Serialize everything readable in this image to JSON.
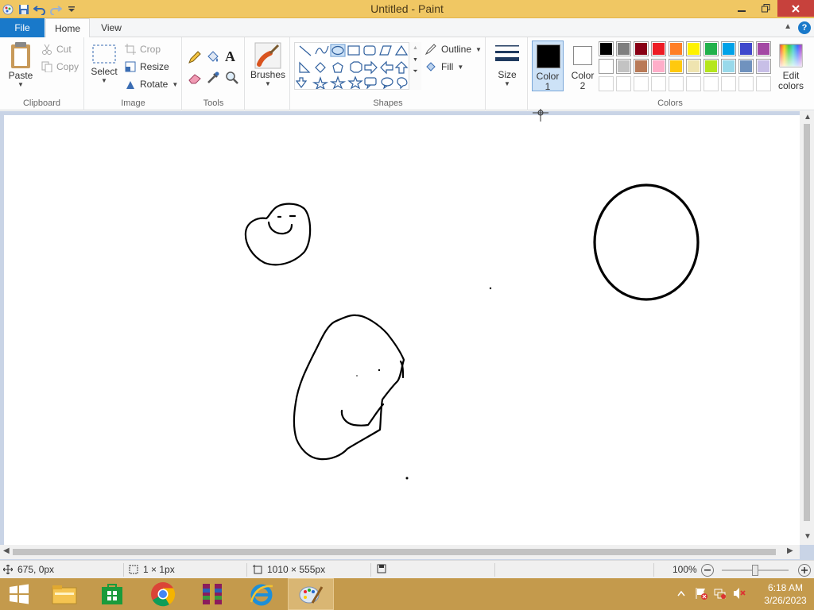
{
  "window": {
    "title": "Untitled - Paint"
  },
  "tabs": {
    "file": "File",
    "home": "Home",
    "view": "View"
  },
  "clipboard": {
    "paste": "Paste",
    "cut": "Cut",
    "copy": "Copy",
    "label": "Clipboard"
  },
  "image": {
    "select": "Select",
    "crop": "Crop",
    "resize": "Resize",
    "rotate": "Rotate",
    "label": "Image"
  },
  "tools": {
    "label": "Tools"
  },
  "brushes": {
    "label": "Brushes"
  },
  "shapes": {
    "outline": "Outline",
    "fill": "Fill",
    "label": "Shapes"
  },
  "size": {
    "label": "Size"
  },
  "colors": {
    "color1_line1": "Color",
    "color1_line2": "1",
    "color2_line1": "Color",
    "color2_line2": "2",
    "edit_line1": "Edit",
    "edit_line2": "colors",
    "label": "Colors",
    "color1_value": "#000000",
    "color2_value": "#ffffff",
    "palette_row1": [
      "#000000",
      "#7f7f7f",
      "#880015",
      "#ed1c24",
      "#ff7f27",
      "#fff200",
      "#22b14c",
      "#00a2e8",
      "#3f48cc",
      "#a349a4"
    ],
    "palette_row2": [
      "#ffffff",
      "#c3c3c3",
      "#b97a57",
      "#ffaec9",
      "#ffc90e",
      "#efe4b0",
      "#b5e61d",
      "#99d9ea",
      "#7092be",
      "#c8bfe7"
    ],
    "palette_row3": [
      "#ffffff",
      "#ffffff",
      "#ffffff",
      "#ffffff",
      "#ffffff",
      "#ffffff",
      "#ffffff",
      "#ffffff",
      "#ffffff",
      "#ffffff"
    ]
  },
  "status": {
    "cursor_pos": "675, 0px",
    "selection_size": "1 × 1px",
    "image_size": "1010 × 555px",
    "zoom": "100%"
  },
  "taskbar": {
    "time": "6:18 AM",
    "date": "3/26/2023"
  }
}
